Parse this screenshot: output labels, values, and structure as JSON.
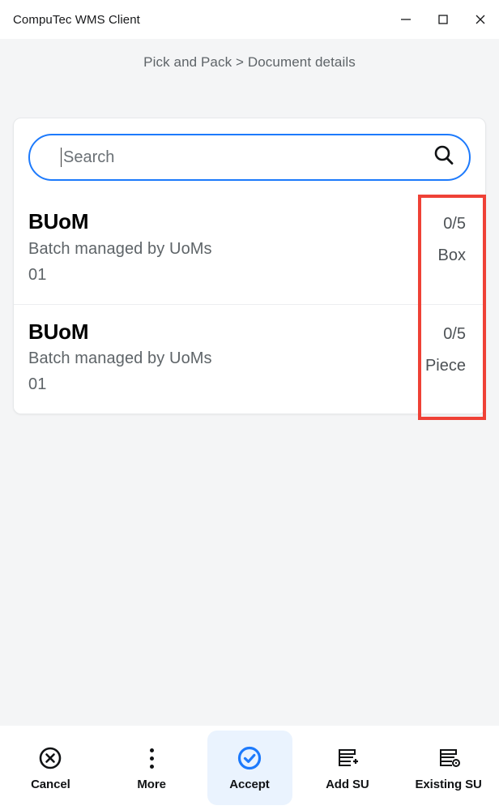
{
  "window": {
    "title": "CompuTec WMS Client",
    "controls": [
      {
        "name": "minimize",
        "icon": "minimize-icon"
      },
      {
        "name": "maximize",
        "icon": "maximize-icon"
      },
      {
        "name": "close",
        "icon": "close-icon"
      }
    ]
  },
  "breadcrumb": {
    "text": "Pick and Pack > Document details"
  },
  "search": {
    "placeholder": "Search",
    "value": "",
    "icon": "search-icon",
    "focused": true,
    "border_color": "#1d7afc"
  },
  "list": {
    "items": [
      {
        "title": "BUoM",
        "subtitle_line1": "Batch managed by UoMs",
        "subtitle_line2": "01",
        "quantity": "0/5",
        "uom": "Box"
      },
      {
        "title": "BUoM",
        "subtitle_line1": "Batch managed by UoMs",
        "subtitle_line2": "01",
        "quantity": "0/5",
        "uom": "Piece"
      }
    ]
  },
  "annotation": {
    "color": "#ef4136",
    "shape": "rectangle"
  },
  "toolbar": {
    "items": [
      {
        "label": "Cancel",
        "icon": "cancel-circle-icon",
        "active": false
      },
      {
        "label": "More",
        "icon": "more-vertical-icon",
        "active": false
      },
      {
        "label": "Accept",
        "icon": "check-circle-icon",
        "active": true
      },
      {
        "label": "Add SU",
        "icon": "add-storage-unit-icon",
        "active": false
      },
      {
        "label": "Existing SU",
        "icon": "existing-storage-unit-icon",
        "active": false
      }
    ],
    "accent_color": "#1d7afc",
    "active_background": "#eaf3fe"
  }
}
